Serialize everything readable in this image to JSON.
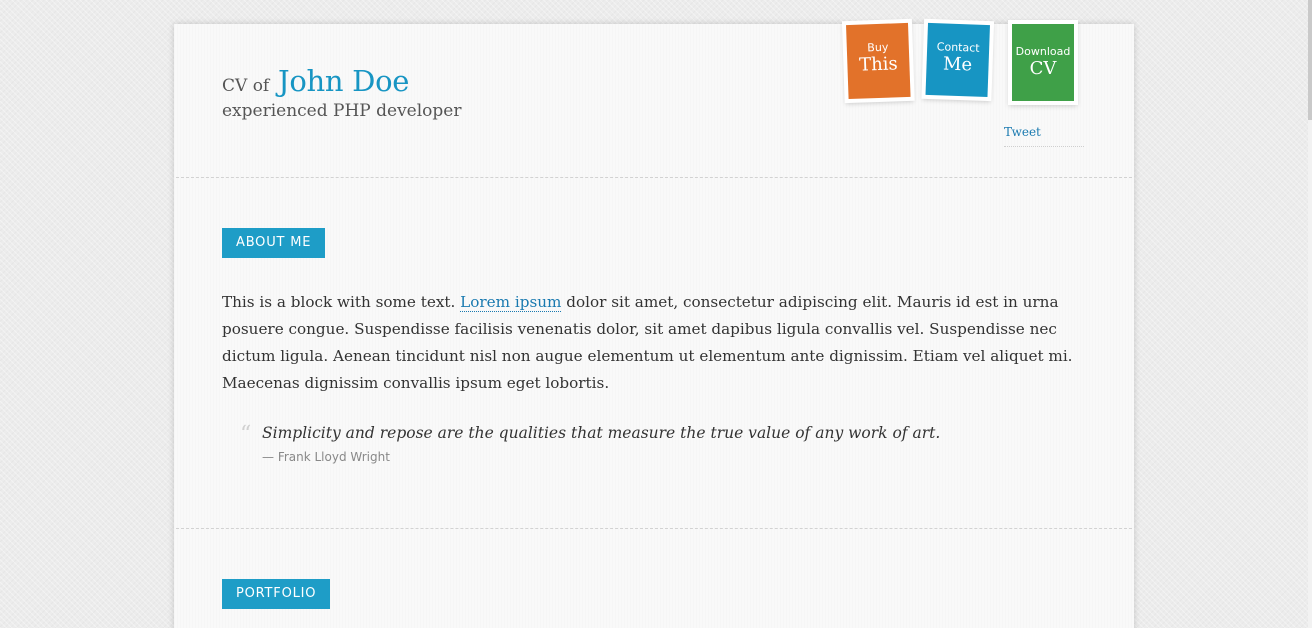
{
  "header": {
    "cv_of": "CV of",
    "name": "John Doe",
    "subtitle": "experienced PHP developer"
  },
  "ribbons": {
    "buy": {
      "small": "Buy",
      "big": "This",
      "color": "#e2722a"
    },
    "contact": {
      "small": "Contact",
      "big": "Me",
      "color": "#1795c3"
    },
    "download": {
      "small": "Download",
      "big": "CV",
      "color": "#3fa048"
    }
  },
  "social": {
    "tweet": "Tweet"
  },
  "about": {
    "label": "ABOUT ME",
    "text_before_link": "This is a block with some text. ",
    "link_text": "Lorem ipsum",
    "text_after_link": " dolor sit amet, consectetur adipiscing elit. Mauris id est in urna posuere congue. Suspendisse facilisis venenatis dolor, sit amet dapibus ligula convallis vel. Suspendisse nec dictum ligula. Aenean tincidunt nisl non augue elementum ut elementum ante dignissim. Etiam vel aliquet mi. Maecenas dignissim convallis ipsum eget lobortis.",
    "quote_mark": "“",
    "quote": "Simplicity and repose are the qualities that measure the true value of any work of art.",
    "quote_author": "— Frank Lloyd Wright"
  },
  "portfolio": {
    "label": "PORTFOLIO"
  },
  "colors": {
    "accent": "#1e9dc7",
    "link": "#1a7ab0",
    "text": "#333333"
  }
}
